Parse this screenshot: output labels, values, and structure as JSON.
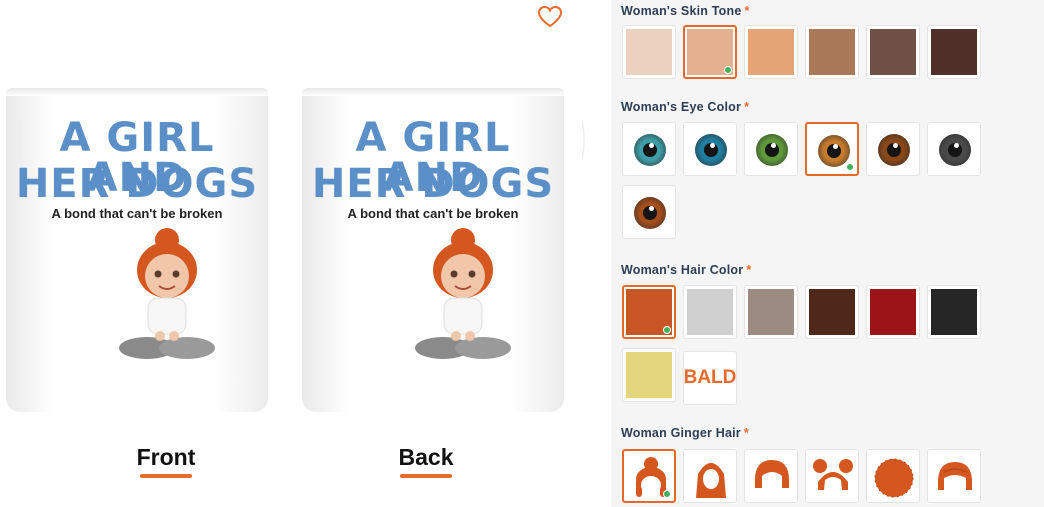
{
  "preview": {
    "mug_title_line1": "A GIRL AND",
    "mug_title_line2": "HER DOGS",
    "mug_subtitle": "A bond that can't be broken",
    "front_label": "Front",
    "back_label": "Back",
    "wishlist_icon": "heart-icon"
  },
  "options": {
    "skin_tone": {
      "label": "Woman's Skin Tone",
      "required_mark": "*",
      "swatches": [
        "#ecd0c0",
        "#e4b190",
        "#e5a476",
        "#a87859",
        "#6f5047",
        "#4f2f28"
      ],
      "selected_index": 1
    },
    "eye_color": {
      "label": "Woman's Eye Color",
      "required_mark": "*",
      "swatches": [
        "#3e9ea8",
        "#1f7fa0",
        "#5f9a3a",
        "#c67a2c",
        "#8a4818",
        "#4a4a4a",
        "#a44e1c"
      ],
      "selected_index": 3
    },
    "hair_color": {
      "label": "Woman's Hair Color",
      "required_mark": "*",
      "swatches": [
        "#c85524",
        "#cfcfcf",
        "#9b8b80",
        "#50281a",
        "#9a1418",
        "#262626",
        "#e4d67c"
      ],
      "bald_label": "BALD",
      "selected_index": 0
    },
    "ginger_hair": {
      "label": "Woman Ginger Hair",
      "required_mark": "*",
      "styles": [
        "bun-updo",
        "long-straight",
        "bob",
        "space-buns",
        "afro",
        "short-pixie"
      ],
      "hair_color": "#d3571f",
      "selected_index": 0
    }
  },
  "colors": {
    "accent": "#e96a2a",
    "selected_check": "#41b15b",
    "mug_text": "#5b8fc7"
  }
}
